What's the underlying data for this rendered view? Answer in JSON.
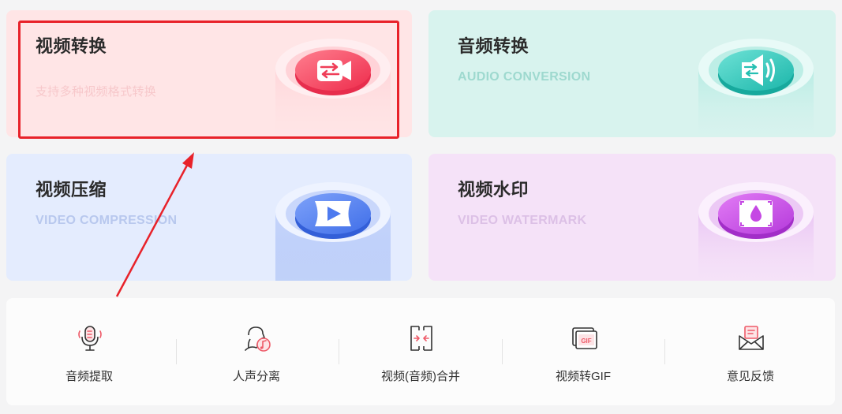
{
  "cards": {
    "video_convert": {
      "title": "视频转换",
      "subtitle": "支持多种视频格式转换"
    },
    "audio_convert": {
      "title": "音频转换",
      "subtitle": "AUDIO CONVERSION"
    },
    "video_compress": {
      "title": "视频压缩",
      "subtitle": "VIDEO COMPRESSION"
    },
    "video_watermark": {
      "title": "视频水印",
      "subtitle": "VIDEO WATERMARK"
    }
  },
  "tools": [
    {
      "label": "音频提取",
      "icon": "microphone-icon"
    },
    {
      "label": "人声分离",
      "icon": "voice-separate-icon"
    },
    {
      "label": "视频(音频)合并",
      "icon": "merge-icon"
    },
    {
      "label": "视频转GIF",
      "icon": "gif-icon"
    },
    {
      "label": "意见反馈",
      "icon": "feedback-mail-icon"
    }
  ],
  "colors": {
    "highlight": "#e8222a",
    "red_accent": "#f0455c",
    "teal_accent": "#2fc9bd",
    "blue_accent": "#4f7df0",
    "purple_accent": "#c64ae6"
  }
}
